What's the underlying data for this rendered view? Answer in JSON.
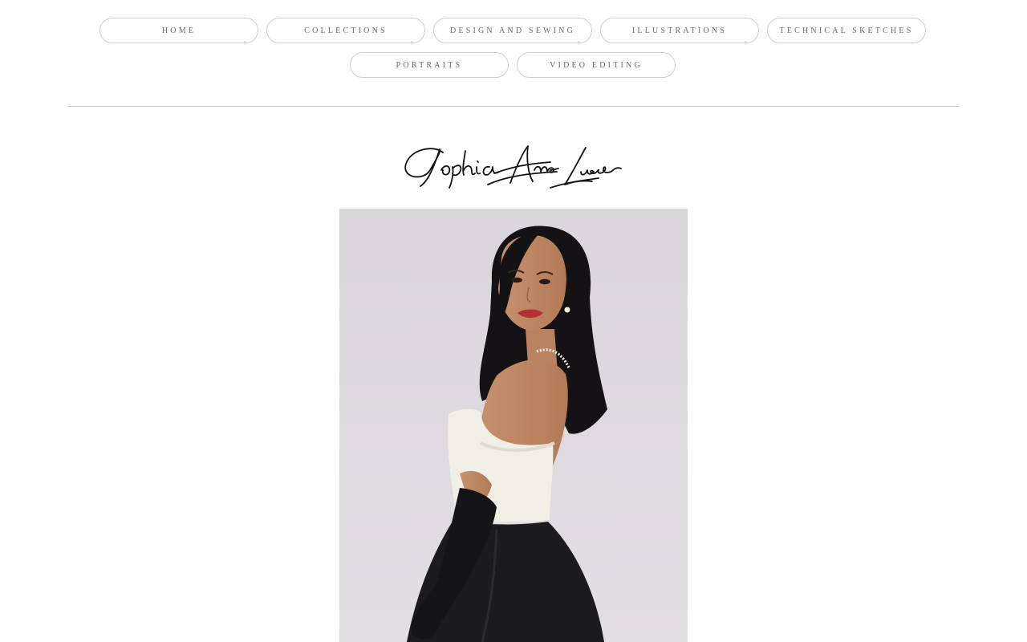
{
  "nav": {
    "items": [
      {
        "label": "HOME"
      },
      {
        "label": "COLLECTIONS"
      },
      {
        "label": "DESIGN AND SEWING"
      },
      {
        "label": "ILLUSTRATIONS"
      },
      {
        "label": "TECHNICAL SKETCHES"
      },
      {
        "label": "PORTRAITS"
      },
      {
        "label": "VIDEO EDITING"
      }
    ]
  },
  "header": {
    "signature": "Sophia Anne Lucas"
  },
  "colors": {
    "pill_border": "#cfcfcf",
    "nav_text": "#6b6b6b",
    "photo_background": "#dcd8de",
    "dress_black": "#1b1b1d",
    "top_cream": "#f1eee6"
  },
  "main": {
    "photo": {
      "icon": "portrait-photo"
    }
  }
}
